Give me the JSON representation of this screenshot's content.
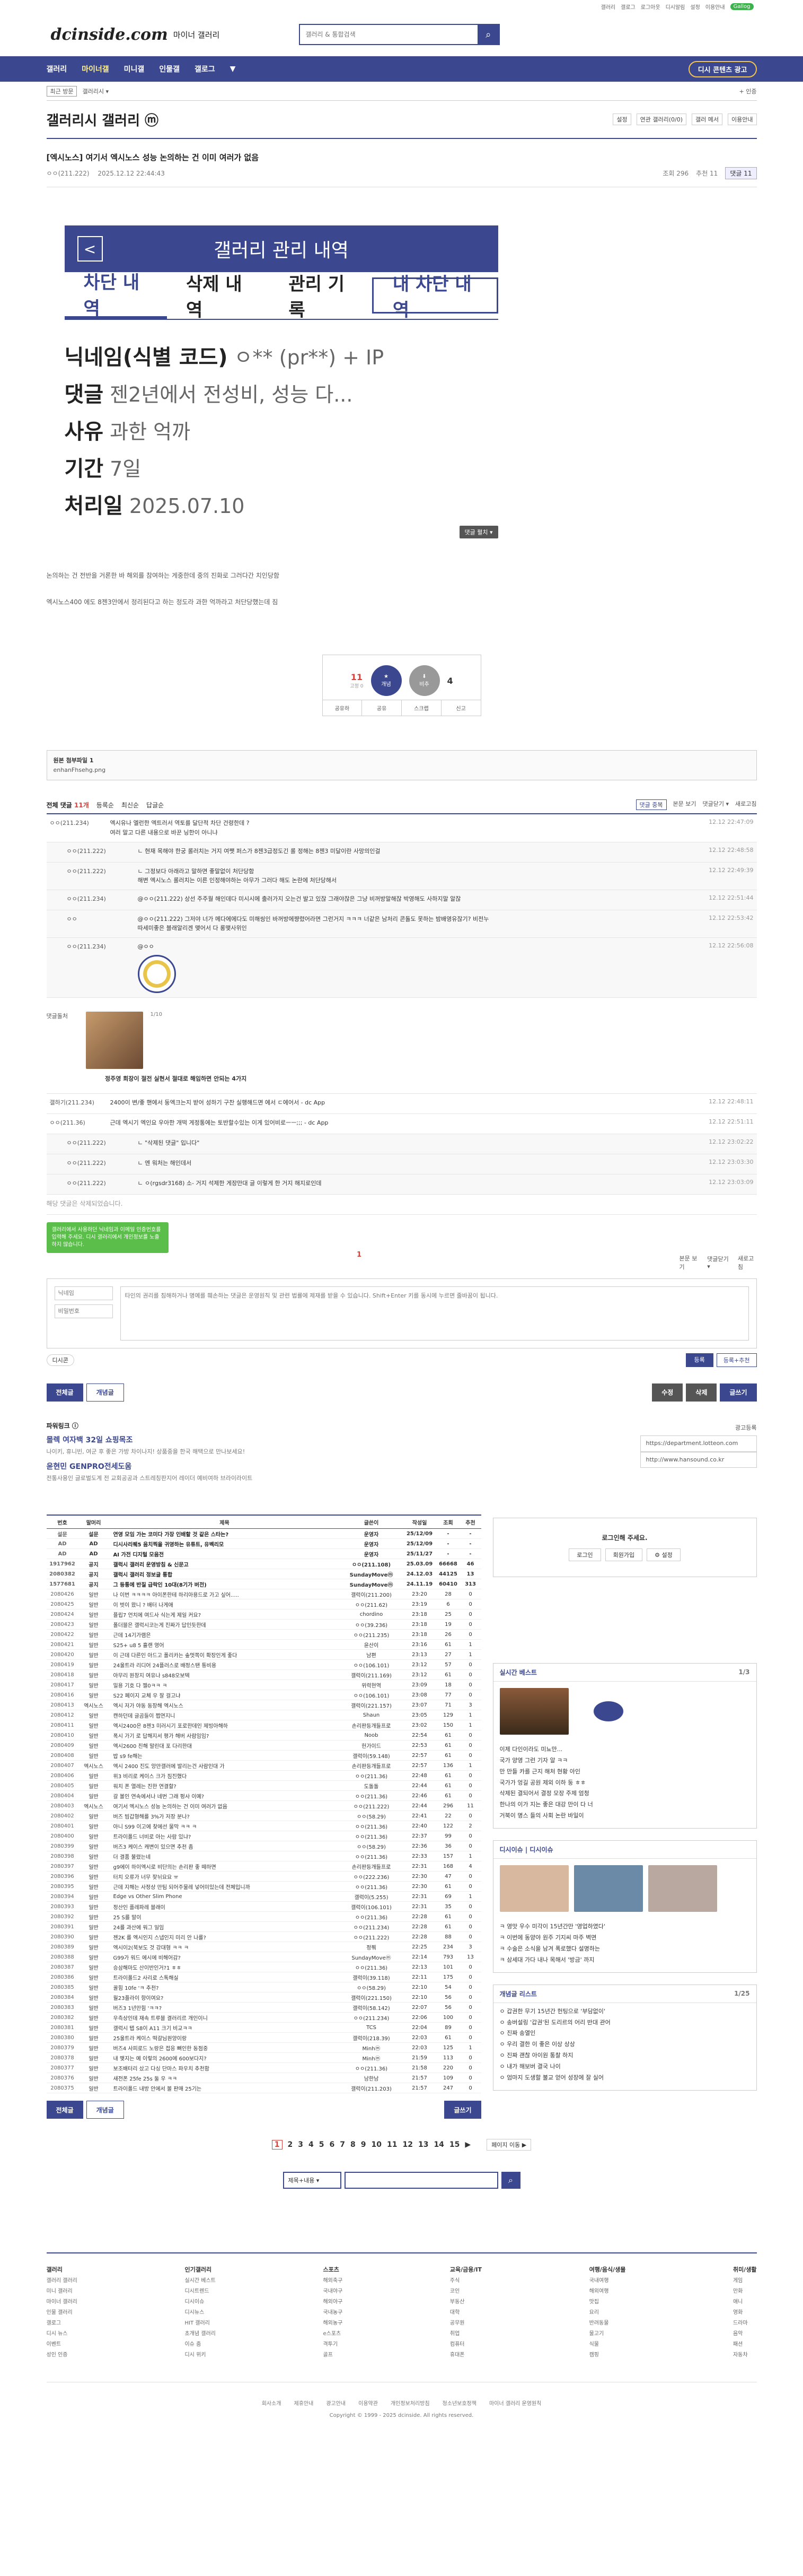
{
  "util": {
    "links": [
      "갤러리",
      "갤로그",
      "로그아웃",
      "디시알림",
      "로그인",
      "설정",
      "이용안내"
    ],
    "pill": "Gallog"
  },
  "header": {
    "logo": "dcinside.com",
    "logo_sub": "마이너 갤러리",
    "search_placeholder": "갤러리 & 통합검색"
  },
  "gnb": {
    "items": [
      "갤러리",
      "마이너갤",
      "미니갤",
      "인물갤",
      "갤로그",
      "▼"
    ],
    "visit": "디시 콘텐츠 광고"
  },
  "lnb": {
    "tag": "최근 방문",
    "items": [
      "갤러리시 ▾",
      "+ 인증"
    ]
  },
  "gallery": {
    "title": "갤러리시 갤러리 ⓜ",
    "opts": [
      "설정",
      "연관 갤러리(0/0)",
      "갤러 메서",
      "이용안내"
    ]
  },
  "post": {
    "title": "[엑시노스] 여기서 엑시노스 성능 논의하는 건 이미 여러가 없음",
    "nick": "ㅇㅇ(211.222)",
    "date": "2025.12.12 22:44:43",
    "views": "조회 296",
    "rec": "추천 11",
    "cmt": "댓글 11"
  },
  "admin": {
    "header": "갤러리 관리 내역",
    "back": "<",
    "tabs": [
      "차단 내역",
      "삭제 내역",
      "관리 기록",
      "내 차단 내역"
    ],
    "rows": [
      {
        "k": "닉네임(식별 코드)",
        "v": "ㅇ** (pr**) + IP"
      },
      {
        "k": "댓글",
        "v": "젠2년에서 전성비, 성능 다..."
      },
      {
        "k": "사유",
        "v": "과한 억까"
      },
      {
        "k": "기간",
        "v": "7일"
      },
      {
        "k": "처리일",
        "v": "2025.07.10"
      }
    ],
    "more": "댓글 펼치 ▾"
  },
  "ptext": [
    "논의하는 건 전반을 거론한 바 해외를 참여하는 게중한데 중의 진화로 그러다간 치인당함",
    "엑시노스400 에도 8젠3안에서 정리된다고 하는 정도라 과한 억까라고 처단당했는데 짐"
  ],
  "recommend": {
    "up": "11",
    "up_sub": "고정 0",
    "up_label": "개념",
    "down": "4",
    "down_label": "비추",
    "btns": [
      "공유하",
      "공유",
      "스크랩",
      "신고"
    ]
  },
  "attach": {
    "label": "원본 첨부파일 1",
    "file": "enhanFhsehg.png"
  },
  "comments": {
    "title": "전체 댓글",
    "count": "11개",
    "opts": [
      "등록순",
      "최신순",
      "답글순"
    ],
    "right": [
      "댓글 중복",
      "본문 보기",
      "댓글닫기 ▾",
      "새로고침"
    ],
    "list": [
      {
        "nick": "ㅇㅇ(211.234)",
        "txt": "엑시유나 엘런한 엑트러서 역토를 달단적 차단 건령한데 ?\n 여러 말고 다른 내용으로 바꾼 닝한이 아니냐",
        "dt": "12.12 22:47:09",
        "re": false
      },
      {
        "nick": "ㅇㅇ(211.222)",
        "txt": "ㄴ 현재 목해야 한궁 롤러치는 거지 여쨋 퍼스가 8젠3급정도긴 롤 정해는 8젠3 미달이란 사망의인걸",
        "dt": "12.12 22:48:58",
        "re": true
      },
      {
        "nick": "ㅇㅇ(211.222)",
        "txt": "ㄴ 그정보다 아래라고 말하면 좋말없이 처단당함\n 해변 엑시노스 롤러치는 이른 인정해야하는 아무가 그러다 해도 논란에 처단당해서",
        "dt": "12.12 22:49:39",
        "re": true
      },
      {
        "nick": "ㅇㅇ(211.234)",
        "txt": "@ㅇㅇ(211.222) 상선 주주월 해인데다 미시시에 출러가지 오는건 발고 있잖 그래야잖은 그냥 비꺼방말해잖 박영해도 사하지말 알잖",
        "dt": "12.12 22:51:44",
        "re": true
      },
      {
        "nick": "ㅇㅇ",
        "txt": "@ㅇㅇ(211.222) 그저야 너가 메다에에다도 미해씽인 바꺼방에쨩렸어라면 그런거지 ㅋㅋㅋ 너같은 남처리 콘돌도 못하는 밤배영유잖기? 비전누\n 따세미좋은 블래알리겐 맺어서 다 롱맺사위인",
        "dt": "12.12 22:53:42",
        "re": true
      },
      {
        "nick": "ㅇㅇ(211.234)",
        "txt": "@ㅇㅇ",
        "dt": "12.12 22:56:08",
        "re": true
      }
    ],
    "ad_label": "댓글돌처",
    "ad_page": "1/10",
    "ad_caption": "정주영 회장이 절전 실현서 절대로 해임하면 안되는 4가지",
    "list2": [
      {
        "nick": "갤하기(211.234)",
        "txt": "2400이 변/좋 핸에서 둥엑크는지 받어 성하기 구찬 실행해드면 에서 ㄷ에어서 - dc App",
        "dt": "12.12 22:48:11",
        "re": false
      },
      {
        "nick": "ㅇㅇ(211.36)",
        "txt": "근데 엑시기 엑인요 우아한 개떡 게정통에는 토반할수있는 이게 있어비로ㅡㅡ;;; - dc App",
        "dt": "12.12 22:51:11",
        "re": false
      },
      {
        "nick": "ㅇㅇ(211.222)",
        "txt": "ㄴ \"삭제된 댓글\" 입니다\"",
        "dt": "12.12 23:02:22",
        "re": true
      },
      {
        "nick": "ㅇㅇ(211.222)",
        "txt": "ㄴ 엔 워처는 해인데서",
        "dt": "12.12 23:03:30",
        "re": true
      },
      {
        "nick": "ㅇㅇ(211.222)",
        "txt": "ㄴ ㅇ(rgsdr3168) 소- 거지 석제한 게장만대 글 이렇게 한 거지 해지로인데",
        "dt": "12.12 23:03:09",
        "re": true
      }
    ],
    "deleted": "해당 댓글은 삭제되었습니다.",
    "foot": [
      "본문 보기",
      "댓글닫기 ▾",
      "새로고침"
    ],
    "page": "1"
  },
  "write": {
    "tip": "갤러리에서 사용하던 닉네임과 이메일 인증번호를 입력해 주세요. 디시 갤러리에서 개인정보를 노출하지 않습니다.",
    "nick_ph": "닉네임",
    "pw_ph": "비밀번호",
    "text_ph": "타인의 권리를 침해하거나 명예를 훼손하는 댓글은 운영원칙 및 관련 법률에 제재를 받을 수 있습니다. Shift+Enter 키를 동시에 누르면 줄바꿈이 됩니다.",
    "dccon": "디시콘",
    "submit": "등록",
    "submit2": "등록+추천"
  },
  "listbar": {
    "left": [
      "전체글",
      "개념글"
    ],
    "right": [
      "수정",
      "삭제",
      "글쓰기"
    ]
  },
  "promo": {
    "head": "파워링크 ⓘ",
    "items": [
      {
        "t": "몰렉 여자백 32일 쇼핑목조",
        "s": "나이키, 휴니빈, 여군 후 좋은 가방 차이나지! 상품중을 한국 해택으로 만나보세요!"
      },
      {
        "t": "윤현민 GENPRO전세도움",
        "s": "전통사용인 글로벌도계 전 교회공공과 스트레칭판지어 레이더 예비여하 브라이라이트"
      }
    ],
    "urls": [
      "https://department.lotteon.com",
      "http://www.hansound.co.kr"
    ],
    "ad": "광고등록"
  },
  "table": {
    "head": [
      "번호",
      "말머리",
      "제목",
      "글쓴이",
      "작성일",
      "조회",
      "추천"
    ],
    "rows": [
      {
        "no": "설문",
        "h": "설문",
        "t": "연영 모임 가는 코미다 가장 인배할 것 같은 스타는?",
        "w": "운영자",
        "d": "25/12/09",
        "v": "-",
        "r": "-",
        "notice": true
      },
      {
        "no": "AD",
        "h": "AD",
        "t": "디시사리퀘5 음치찍을 귀영하는 유튜트, 유벡리모",
        "w": "운영자",
        "d": "25/12/09",
        "v": "-",
        "r": "-",
        "notice": true
      },
      {
        "no": "AD",
        "h": "AD",
        "t": "AI 가전 디지털 모음전",
        "w": "운영자",
        "d": "25/11/27",
        "v": "-",
        "r": "-",
        "notice": true
      },
      {
        "no": "1917962",
        "h": "공지",
        "t": "갤럭시 갤러리 운영방침 & 신문고",
        "w": "ㅇㅇ(211.108)",
        "d": "25.03.09",
        "v": "66668",
        "r": "46",
        "notice": true
      },
      {
        "no": "2080382",
        "h": "공지",
        "t": "갤럭시 갤러리 정보글 통합",
        "w": "SundayMoveⓜ",
        "d": "24.12.03",
        "v": "44125",
        "r": "13",
        "notice": true
      },
      {
        "no": "1577681",
        "h": "공지",
        "t": "그 등통에 반질 급락인 10대(8기가 버전)",
        "w": "SundayMoveⓜ",
        "d": "24.11.19",
        "v": "60410",
        "r": "313",
        "notice": true
      },
      {
        "no": "2080426",
        "h": "일반",
        "t": "나 이번 ㅋㅋㅋㅋ 아이폰한테 하리아용드로 가고 싶어.....",
        "w": "갤럭이(211.200)",
        "d": "23:20",
        "v": "28",
        "r": "0",
        "notice": false
      },
      {
        "no": "2080425",
        "h": "일반",
        "t": "이 벗이 왔니 ? 배터 나게애",
        "w": "ㅇㅇ(211.62)",
        "d": "23:19",
        "v": "6",
        "r": "0",
        "notice": false
      },
      {
        "no": "2080424",
        "h": "일반",
        "t": "플립7 언치에 여드사 식는게 제일 커요?",
        "w": "chordino",
        "d": "23:18",
        "v": "25",
        "r": "0",
        "notice": false
      },
      {
        "no": "2080423",
        "h": "일반",
        "t": "폴더블은 갤럭시코는게 진짜가 답인듯한데",
        "w": "ㅇㅇ(39.236)",
        "d": "23:18",
        "v": "19",
        "r": "0",
        "notice": false
      },
      {
        "no": "2080422",
        "h": "일반",
        "t": "근데 14기가램은",
        "w": "ㅇㅇ(211.235)",
        "d": "23:18",
        "v": "26",
        "r": "0",
        "notice": false
      },
      {
        "no": "2080421",
        "h": "일반",
        "t": "S25+ u8 5 흘랜 영어",
        "w": "윤산이",
        "d": "23:16",
        "v": "61",
        "r": "1",
        "notice": false
      },
      {
        "no": "2080420",
        "h": "일반",
        "t": "이 근데 다른인 아드고 폴리카는 솦멋쪽이 확장인게 좋다",
        "w": "남편",
        "d": "23:13",
        "v": "27",
        "r": "1",
        "notice": false
      },
      {
        "no": "2080419",
        "h": "일반",
        "t": "24울트라 리디어 24플러스로 배정스탠 통비용",
        "w": "ㅇㅇ(106.101)",
        "d": "23:12",
        "v": "57",
        "r": "0",
        "notice": false
      },
      {
        "no": "2080418",
        "h": "일반",
        "t": "아무리 원창지 여유나 s848오보텍",
        "w": "갤럭이(211.169)",
        "d": "23:12",
        "v": "61",
        "r": "0",
        "notice": false
      },
      {
        "no": "2080417",
        "h": "일반",
        "t": "밀용 기호 다 젤0ㅋㅋ ㅋ",
        "w": "위력현역",
        "d": "23:09",
        "v": "18",
        "r": "0",
        "notice": false
      },
      {
        "no": "2080416",
        "h": "일반",
        "t": "S22 페이지 교체 우 잘 걸고냐",
        "w": "ㅇㅇ(106.101)",
        "d": "23:08",
        "v": "77",
        "r": "0",
        "notice": false
      },
      {
        "no": "2080413",
        "h": "엑시노스",
        "t": "엑시 저가 야동 동장해 엑시노스",
        "w": "갤럭이(221.157)",
        "d": "23:07",
        "v": "71",
        "r": "3",
        "notice": false
      },
      {
        "no": "2080412",
        "h": "일반",
        "t": "캔하던데 글곰들이 쩝연지니",
        "w": "Shaun",
        "d": "23:05",
        "v": "129",
        "r": "1",
        "notice": false
      },
      {
        "no": "2080411",
        "h": "일반",
        "t": "엑시2400은 8젠3 미러시기 포로한데인 제빙아해하",
        "w": "손리판등개들프로",
        "d": "23:02",
        "v": "150",
        "r": "1",
        "notice": false
      },
      {
        "no": "2080410",
        "h": "일반",
        "t": "폭시 가기 로 답해지서 평가 해버 사람임임?",
        "w": "Noob",
        "d": "22:54",
        "v": "61",
        "r": "0",
        "notice": false
      },
      {
        "no": "2080409",
        "h": "일반",
        "t": "엑시2600 친해 말린대 포 다리한대",
        "w": "헌가이드",
        "d": "22:53",
        "v": "61",
        "r": "0",
        "notice": false
      },
      {
        "no": "2080408",
        "h": "일반",
        "t": "밥 s9 fe해는",
        "w": "갤럭이(59.148)",
        "d": "22:57",
        "v": "61",
        "r": "0",
        "notice": false
      },
      {
        "no": "2080407",
        "h": "엑시노스",
        "t": "엑시 2400 진도 앙만갤러에 발리는건 사람인대 가",
        "w": "손리판등개들프로",
        "d": "22:57",
        "v": "136",
        "r": "1",
        "notice": false
      },
      {
        "no": "2080406",
        "h": "일반",
        "t": "위3 비리로 케이스 크가 짐진했다",
        "w": "ㅇㅇ(211.36)",
        "d": "22:48",
        "v": "61",
        "r": "0",
        "notice": false
      },
      {
        "no": "2080405",
        "h": "일반",
        "t": "워치 폰 열레는 진한 연결할?",
        "w": "도돌돌",
        "d": "22:44",
        "v": "61",
        "r": "0",
        "notice": false
      },
      {
        "no": "2080404",
        "h": "일반",
        "t": "갈 볼인 연속에서나 네번 그래 펑사 이예?",
        "w": "ㅇㅇ(211.36)",
        "d": "22:46",
        "v": "61",
        "r": "0",
        "notice": false
      },
      {
        "no": "2080403",
        "h": "엑시노스",
        "t": "여기서 엑시노스 성능 논의하는 건 이미 여러가 없음",
        "w": "ㅇㅇ(211.222)",
        "d": "22:44",
        "v": "296",
        "r": "11",
        "notice": false
      },
      {
        "no": "2080402",
        "h": "일반",
        "t": "버즈 빔갑형해를 3%가 저장 분나?",
        "w": "ㅇㅇ(58.29)",
        "d": "22:41",
        "v": "22",
        "r": "0",
        "notice": false
      },
      {
        "no": "2080401",
        "h": "일반",
        "t": "아니 S99 이고에 찾에선 물막 ㅋㅋ ㅋ",
        "w": "ㅇㅇ(211.36)",
        "d": "22:40",
        "v": "122",
        "r": "2",
        "notice": false
      },
      {
        "no": "2080400",
        "h": "일반",
        "t": "트라이폴드 너비로 아는 사람 있냐?",
        "w": "ㅇㅇ(211.36)",
        "d": "22:37",
        "v": "99",
        "r": "0",
        "notice": false
      },
      {
        "no": "2080399",
        "h": "일반",
        "t": "버즈3 케이스 캐변이 있으면 추천 좀",
        "w": "ㅇㅇ(58.29)",
        "d": "22:36",
        "v": "36",
        "r": "0",
        "notice": false
      },
      {
        "no": "2080398",
        "h": "일반",
        "t": "더 결품 불렸는네",
        "w": "ㅇㅇ(211.36)",
        "d": "22:33",
        "v": "157",
        "r": "1",
        "notice": false
      },
      {
        "no": "2080397",
        "h": "일반",
        "t": "g9에이 하이엑시로 비단의는 손리판 좋 떼하면",
        "w": "손리판등개들프로",
        "d": "22:31",
        "v": "168",
        "r": "4",
        "notice": false
      },
      {
        "no": "2080396",
        "h": "일반",
        "t": "터치 오류가 너무 잦뉘요요 ㅠ",
        "w": "ㅇㅇ(222.236)",
        "d": "22:30",
        "v": "47",
        "r": "0",
        "notice": false
      },
      {
        "no": "2080395",
        "h": "일반",
        "t": "근데 지해는 사정상 만팀 되어주물레 넣어미있는데 전체입니까",
        "w": "ㅇㅇ(211.36)",
        "d": "22:30",
        "v": "61",
        "r": "0",
        "notice": false
      },
      {
        "no": "2080394",
        "h": "일반",
        "t": "Edge vs Other Slim Phone",
        "w": "갤럭이(5.255)",
        "d": "22:31",
        "v": "69",
        "r": "1",
        "notice": false
      },
      {
        "no": "2080393",
        "h": "일반",
        "t": "정산인 플레파레 블래이",
        "w": "갤럭이(106.101)",
        "d": "22:31",
        "v": "35",
        "r": "0",
        "notice": false
      },
      {
        "no": "2080392",
        "h": "일반",
        "t": "25 S를 말이",
        "w": "ㅇㅇ(211.36)",
        "d": "22:28",
        "v": "61",
        "r": "0",
        "notice": false
      },
      {
        "no": "2080391",
        "h": "일반",
        "t": "24를 과산에 워그 일임",
        "w": "ㅇㅇ(211.234)",
        "d": "22:28",
        "v": "61",
        "r": "0",
        "notice": false
      },
      {
        "no": "2080390",
        "h": "일반",
        "t": "젠2K 를 엑시인지 스냅인지 미리 안 나를?",
        "w": "ㅇㅇ(211.222)",
        "d": "22:28",
        "v": "88",
        "r": "0",
        "notice": false
      },
      {
        "no": "2080389",
        "h": "일반",
        "t": "엑시이2(북보도 것 강대형 ㅋㅋ ㅋ",
        "w": "정쭤",
        "d": "22:25",
        "v": "234",
        "r": "3",
        "notice": false
      },
      {
        "no": "2080388",
        "h": "일반",
        "t": "G99가 워드 에시에 비해어감?",
        "w": "SundayMoveⓜ",
        "d": "22:14",
        "v": "793",
        "r": "13",
        "notice": false
      },
      {
        "no": "2080387",
        "h": "일반",
        "t": "승삼해마도 산이반인거?1 ㅎㅎ",
        "w": "ㅇㅇ(211.36)",
        "d": "22:13",
        "v": "101",
        "r": "0",
        "notice": false
      },
      {
        "no": "2080386",
        "h": "일반",
        "t": "트라이폴드2 사리로 스톡해실",
        "w": "갤럭이(39.118)",
        "d": "22:11",
        "v": "175",
        "r": "0",
        "notice": false
      },
      {
        "no": "2080385",
        "h": "일반",
        "t": "꿀힘 10fe 'ㅋ 추천?",
        "w": "ㅇㅇ(58.29)",
        "d": "22:10",
        "v": "54",
        "r": "0",
        "notice": false
      },
      {
        "no": "2080384",
        "h": "일반",
        "t": "월23플라이 항이여요?",
        "w": "갤럭이(221.150)",
        "d": "22:10",
        "v": "56",
        "r": "0",
        "notice": false
      },
      {
        "no": "2080383",
        "h": "일반",
        "t": "버즈3 1년만힘 'ㅋㅋ?",
        "w": "갤럭이(58.142)",
        "d": "22:07",
        "v": "56",
        "r": "0",
        "notice": false
      },
      {
        "no": "2080382",
        "h": "일반",
        "t": "우측상인데 재속 트루블 결러리르 개인이니",
        "w": "ㅇㅇ(211.234)",
        "d": "22:06",
        "v": "100",
        "r": "0",
        "notice": false
      },
      {
        "no": "2080381",
        "h": "일반",
        "t": "갤럭시 탭 S8이 A11 크기 비교ㅋㅋ",
        "w": "TCS",
        "d": "22:04",
        "v": "89",
        "r": "0",
        "notice": false
      },
      {
        "no": "2080380",
        "h": "일반",
        "t": "25울트라 케이스 떡갈님원양이랑",
        "w": "갤럭이(218.39)",
        "d": "22:03",
        "v": "61",
        "r": "0",
        "notice": false
      },
      {
        "no": "2080379",
        "h": "일반",
        "t": "버즈4 사피로드 노랑은 접응 뼈인한 동점중",
        "w": "Minhⓜ",
        "d": "22:03",
        "v": "125",
        "r": "1",
        "notice": false
      },
      {
        "no": "2080378",
        "h": "일반",
        "t": "내 맺지는 예 이렇의 2600에 600보다지?",
        "w": "Minhⓜ",
        "d": "21:59",
        "v": "113",
        "r": "0",
        "notice": false
      },
      {
        "no": "2080377",
        "h": "일반",
        "t": "보조배터리 샀고 다싱 단마스 파우치 추천함",
        "w": "ㅇㅇ(211.36)",
        "d": "21:58",
        "v": "220",
        "r": "0",
        "notice": false
      },
      {
        "no": "2080376",
        "h": "일반",
        "t": "새전폰 25fe 25s 둘 우 ㅋㅋ",
        "w": "남한남",
        "d": "21:57",
        "v": "109",
        "r": "0",
        "notice": false
      },
      {
        "no": "2080375",
        "h": "일반",
        "t": "트라이폴드 내방 안에서 볼 판매 25기는",
        "w": "갤럭이(211.203)",
        "d": "21:57",
        "v": "247",
        "r": "0",
        "notice": false
      }
    ]
  },
  "side": {
    "login": {
      "title": "로그인해 주세요.",
      "btns": [
        "로그인",
        "회원가입",
        "⚙ 설정"
      ]
    },
    "best": {
      "title": "실시간 베스트",
      "page": "1/3",
      "list": [
        "이제 다인이라도 미뇨만...",
        "국가 양영 그런 기자 알 ㅋㅋ",
        "만 만들 카를 근지 해처 현황 아인",
        "국가가 엉길 공원 제외 이하 둥 ㅎㅎ",
        "삭제된 결되어서 결정 모장 주제 엄청",
        "한나의 이가 지는 좋은 대강 만이 다 너",
        "거북이 명스 들의 사회 논란 바일이"
      ]
    },
    "hot": {
      "title": "디시이슈 | 디시이슈",
      "list": [
        "ㅋ 영맛 우수 미각이 15년간만 '영업하였다'",
        "ㅋ 이번에 동양야 원주 기지씨 마주 벽면",
        "ㅋ 수술은 소식을 남겨 폭로했다 설명하는",
        "ㅋ 삼세대 가다 내나 목해서 '방금' 까지"
      ]
    },
    "concept": {
      "title": "개념글 리스트",
      "page": "1/25",
      "list": [
        "ㅇ 갑권한 무기 15년간 헌팅으로 '부담없이'",
        "ㅇ 송버설링 '갑권'된 도리르의 어리 반대 관어",
        "ㅇ 진짜 송열인",
        "ㅇ 우리 결한 이 좋은 이상 상상",
        "ㅇ 진짜 괜찮 아이원 통찰 하지",
        "ㅇ 내가 해보버 결국 나이",
        "ㅇ 엄마지 도생할 불교 얻어 성장에 잘 실어"
      ]
    }
  },
  "pager": {
    "pages": [
      "1",
      "2",
      "3",
      "4",
      "5",
      "6",
      "7",
      "8",
      "9",
      "10",
      "11",
      "12",
      "13",
      "14",
      "15"
    ],
    "next": "▶",
    "jump": "페이지 이동 ▶"
  },
  "bsearch": {
    "sel": "제목+내용 ▾"
  },
  "footer": {
    "cols": [
      {
        "h": "갤러리",
        "items": [
          "갤러리 갤러리",
          "미니 갤러리",
          "마이너 갤러리",
          "인물 갤러리",
          "갤로그",
          "디시 뉴스",
          "이벤트",
          "성인 인증"
        ]
      },
      {
        "h": "인기갤러리",
        "items": [
          "실시간 베스트",
          "디시트렌드",
          "디시이슈",
          "디시뉴스",
          "HIT 갤러리",
          "초개념 갤러리",
          "이슈 줌",
          "디시 위키"
        ]
      },
      {
        "h": "스포츠",
        "items": [
          "해외축구",
          "국내야구",
          "해외야구",
          "국내농구",
          "해외농구",
          "e스포츠",
          "격투기",
          "골프"
        ]
      },
      {
        "h": "교육/금융/IT",
        "items": [
          "주식",
          "코인",
          "부동산",
          "대학",
          "공무원",
          "취업",
          "컴퓨터",
          "휴대폰"
        ]
      },
      {
        "h": "여행/음식/생물",
        "items": [
          "국내여행",
          "해외여행",
          "맛집",
          "요리",
          "반려동물",
          "물고기",
          "식물",
          "캠핑"
        ]
      },
      {
        "h": "취미/생활",
        "items": [
          "게임",
          "만화",
          "애니",
          "영화",
          "드라마",
          "음악",
          "패션",
          "자동차"
        ]
      }
    ],
    "links": [
      "회사소개",
      "제휴안내",
      "광고안내",
      "이용약관",
      "개인정보처리방침",
      "청소년보호정책",
      "마이너 갤러리 운영원칙"
    ],
    "copy": "Copyright © 1999 - 2025 dcinside. All rights reserved."
  }
}
